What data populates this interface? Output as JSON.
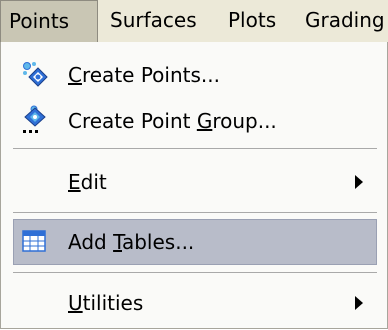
{
  "menubar": {
    "items": [
      {
        "label": "Points",
        "active": true
      },
      {
        "label": "Surfaces",
        "active": false
      },
      {
        "label": "Plots",
        "active": false
      },
      {
        "label": "Grading",
        "active": false
      }
    ]
  },
  "dropdown": {
    "items": [
      {
        "pre": "",
        "accel": "C",
        "post": "reate Points...",
        "icon": "create-points-icon",
        "submenu": false
      },
      {
        "pre": "Create Point ",
        "accel": "G",
        "post": "roup...",
        "icon": "create-point-group-icon",
        "submenu": false
      },
      {
        "pre": "",
        "accel": "E",
        "post": "dit",
        "icon": "",
        "submenu": true
      },
      {
        "pre": "Add ",
        "accel": "T",
        "post": "ables...",
        "icon": "table-icon",
        "submenu": false,
        "highlighted": true
      },
      {
        "pre": "",
        "accel": "U",
        "post": "tilities",
        "icon": "",
        "submenu": true
      }
    ]
  },
  "colors": {
    "menubar_bg": "#ece9d8",
    "menu_bg": "#fafaf8",
    "highlight": "#b8bcc9",
    "icon_blue": "#2f6fd6",
    "icon_cyan": "#5fb8ea"
  }
}
